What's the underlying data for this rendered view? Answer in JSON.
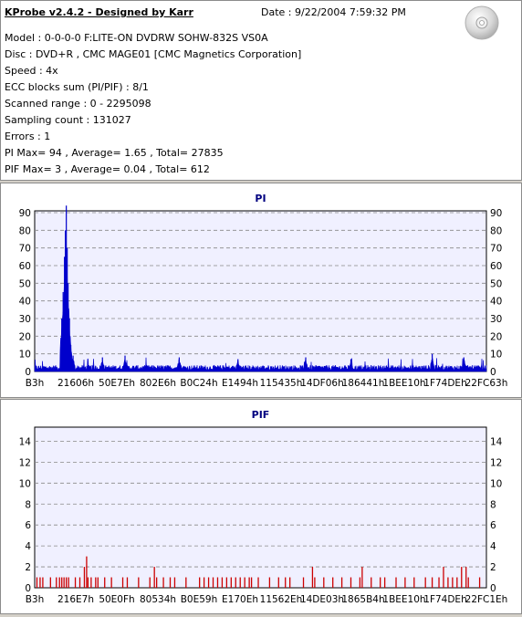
{
  "header": {
    "title": "KProbe v2.4.2 - Designed by Karr",
    "date": "Date : 9/22/2004 7:59:32 PM"
  },
  "info_lines": [
    "Model : 0-0-0-0 F:LITE-ON DVDRW SOHW-832S  VS0A",
    "Disc : DVD+R , CMC MAGE01 [CMC Magnetics Corporation]",
    "Speed : 4x",
    "ECC blocks sum (PI/PIF) : 8/1",
    "Scanned range : 0 - 2295098",
    "Sampling count : 131027",
    "Errors : 1",
    "PI Max= 94 , Average= 1.65 , Total= 27835",
    "PIF Max= 3 , Average= 0.04 , Total= 612"
  ],
  "icons": {
    "disc": "cd-disc-icon"
  },
  "chart_data": [
    {
      "type": "area",
      "title": "PI",
      "ylim": [
        0,
        90
      ],
      "yticks": [
        0,
        10,
        20,
        30,
        40,
        50,
        60,
        70,
        80,
        90
      ],
      "xticks": [
        "B3h",
        "21606h",
        "50E7Eh",
        "802E6h",
        "B0C24h",
        "E1494h",
        "115435h",
        "14DF06h",
        "186441h",
        "1BEE10h",
        "1F74DEh",
        "22FC63h"
      ],
      "grid": true,
      "color": "#0000cc",
      "series": [
        {
          "baseline": 2,
          "peaks": [
            {
              "x": 0.06,
              "value": 30
            },
            {
              "x": 0.063,
              "value": 45
            },
            {
              "x": 0.066,
              "value": 65
            },
            {
              "x": 0.068,
              "value": 80
            },
            {
              "x": 0.07,
              "value": 94
            },
            {
              "x": 0.072,
              "value": 70
            },
            {
              "x": 0.074,
              "value": 50
            },
            {
              "x": 0.077,
              "value": 30
            },
            {
              "x": 0.08,
              "value": 15
            },
            {
              "x": 0.085,
              "value": 9
            },
            {
              "x": 0.15,
              "value": 8
            },
            {
              "x": 0.2,
              "value": 9
            },
            {
              "x": 0.32,
              "value": 8
            },
            {
              "x": 0.45,
              "value": 7
            },
            {
              "x": 0.6,
              "value": 8
            },
            {
              "x": 0.7,
              "value": 7
            },
            {
              "x": 0.88,
              "value": 10
            },
            {
              "x": 0.95,
              "value": 8
            }
          ]
        }
      ]
    },
    {
      "type": "bar",
      "title": "PIF",
      "ylim": [
        0,
        15
      ],
      "yticks": [
        0,
        2,
        4,
        6,
        8,
        10,
        12,
        14
      ],
      "xticks": [
        "B3h",
        "216E7h",
        "50E0Fh",
        "80534h",
        "B0E59h",
        "E170Eh",
        "11562Eh",
        "14DE03h",
        "1865B4h",
        "1BEE10h",
        "1F74DEh",
        "22FC1Eh"
      ],
      "grid": true,
      "color": "#cc0000",
      "bars": [
        {
          "x": 0.005,
          "value": 1
        },
        {
          "x": 0.012,
          "value": 1
        },
        {
          "x": 0.018,
          "value": 1
        },
        {
          "x": 0.035,
          "value": 1
        },
        {
          "x": 0.048,
          "value": 1
        },
        {
          "x": 0.055,
          "value": 1
        },
        {
          "x": 0.06,
          "value": 1
        },
        {
          "x": 0.065,
          "value": 1
        },
        {
          "x": 0.07,
          "value": 1
        },
        {
          "x": 0.075,
          "value": 1
        },
        {
          "x": 0.09,
          "value": 1
        },
        {
          "x": 0.1,
          "value": 1
        },
        {
          "x": 0.11,
          "value": 2
        },
        {
          "x": 0.118,
          "value": 1
        },
        {
          "x": 0.125,
          "value": 1
        },
        {
          "x": 0.135,
          "value": 1
        },
        {
          "x": 0.14,
          "value": 1
        },
        {
          "x": 0.155,
          "value": 1
        },
        {
          "x": 0.17,
          "value": 1
        },
        {
          "x": 0.195,
          "value": 1
        },
        {
          "x": 0.205,
          "value": 1
        },
        {
          "x": 0.23,
          "value": 1
        },
        {
          "x": 0.255,
          "value": 1
        },
        {
          "x": 0.27,
          "value": 1
        },
        {
          "x": 0.285,
          "value": 1
        },
        {
          "x": 0.3,
          "value": 1
        },
        {
          "x": 0.31,
          "value": 1
        },
        {
          "x": 0.335,
          "value": 1
        },
        {
          "x": 0.365,
          "value": 1
        },
        {
          "x": 0.375,
          "value": 1
        },
        {
          "x": 0.385,
          "value": 1
        },
        {
          "x": 0.395,
          "value": 1
        },
        {
          "x": 0.405,
          "value": 1
        },
        {
          "x": 0.415,
          "value": 1
        },
        {
          "x": 0.425,
          "value": 1
        },
        {
          "x": 0.435,
          "value": 1
        },
        {
          "x": 0.445,
          "value": 1
        },
        {
          "x": 0.455,
          "value": 1
        },
        {
          "x": 0.465,
          "value": 1
        },
        {
          "x": 0.475,
          "value": 1
        },
        {
          "x": 0.48,
          "value": 1
        },
        {
          "x": 0.495,
          "value": 1
        },
        {
          "x": 0.52,
          "value": 1
        },
        {
          "x": 0.54,
          "value": 1
        },
        {
          "x": 0.555,
          "value": 1
        },
        {
          "x": 0.565,
          "value": 1
        },
        {
          "x": 0.595,
          "value": 1
        },
        {
          "x": 0.62,
          "value": 1
        },
        {
          "x": 0.64,
          "value": 1
        },
        {
          "x": 0.66,
          "value": 1
        },
        {
          "x": 0.68,
          "value": 1
        },
        {
          "x": 0.7,
          "value": 1
        },
        {
          "x": 0.72,
          "value": 1
        },
        {
          "x": 0.745,
          "value": 1
        },
        {
          "x": 0.765,
          "value": 1
        },
        {
          "x": 0.775,
          "value": 1
        },
        {
          "x": 0.8,
          "value": 1
        },
        {
          "x": 0.82,
          "value": 1
        },
        {
          "x": 0.84,
          "value": 1
        },
        {
          "x": 0.865,
          "value": 1
        },
        {
          "x": 0.88,
          "value": 1
        },
        {
          "x": 0.895,
          "value": 1
        },
        {
          "x": 0.905,
          "value": 2
        },
        {
          "x": 0.915,
          "value": 1
        },
        {
          "x": 0.925,
          "value": 1
        },
        {
          "x": 0.935,
          "value": 1
        },
        {
          "x": 0.945,
          "value": 2
        },
        {
          "x": 0.96,
          "value": 1
        },
        {
          "x": 0.985,
          "value": 1
        },
        {
          "x": 0.115,
          "value": 3
        },
        {
          "x": 0.265,
          "value": 2
        },
        {
          "x": 0.615,
          "value": 2
        },
        {
          "x": 0.725,
          "value": 2
        },
        {
          "x": 0.955,
          "value": 2
        }
      ]
    }
  ]
}
